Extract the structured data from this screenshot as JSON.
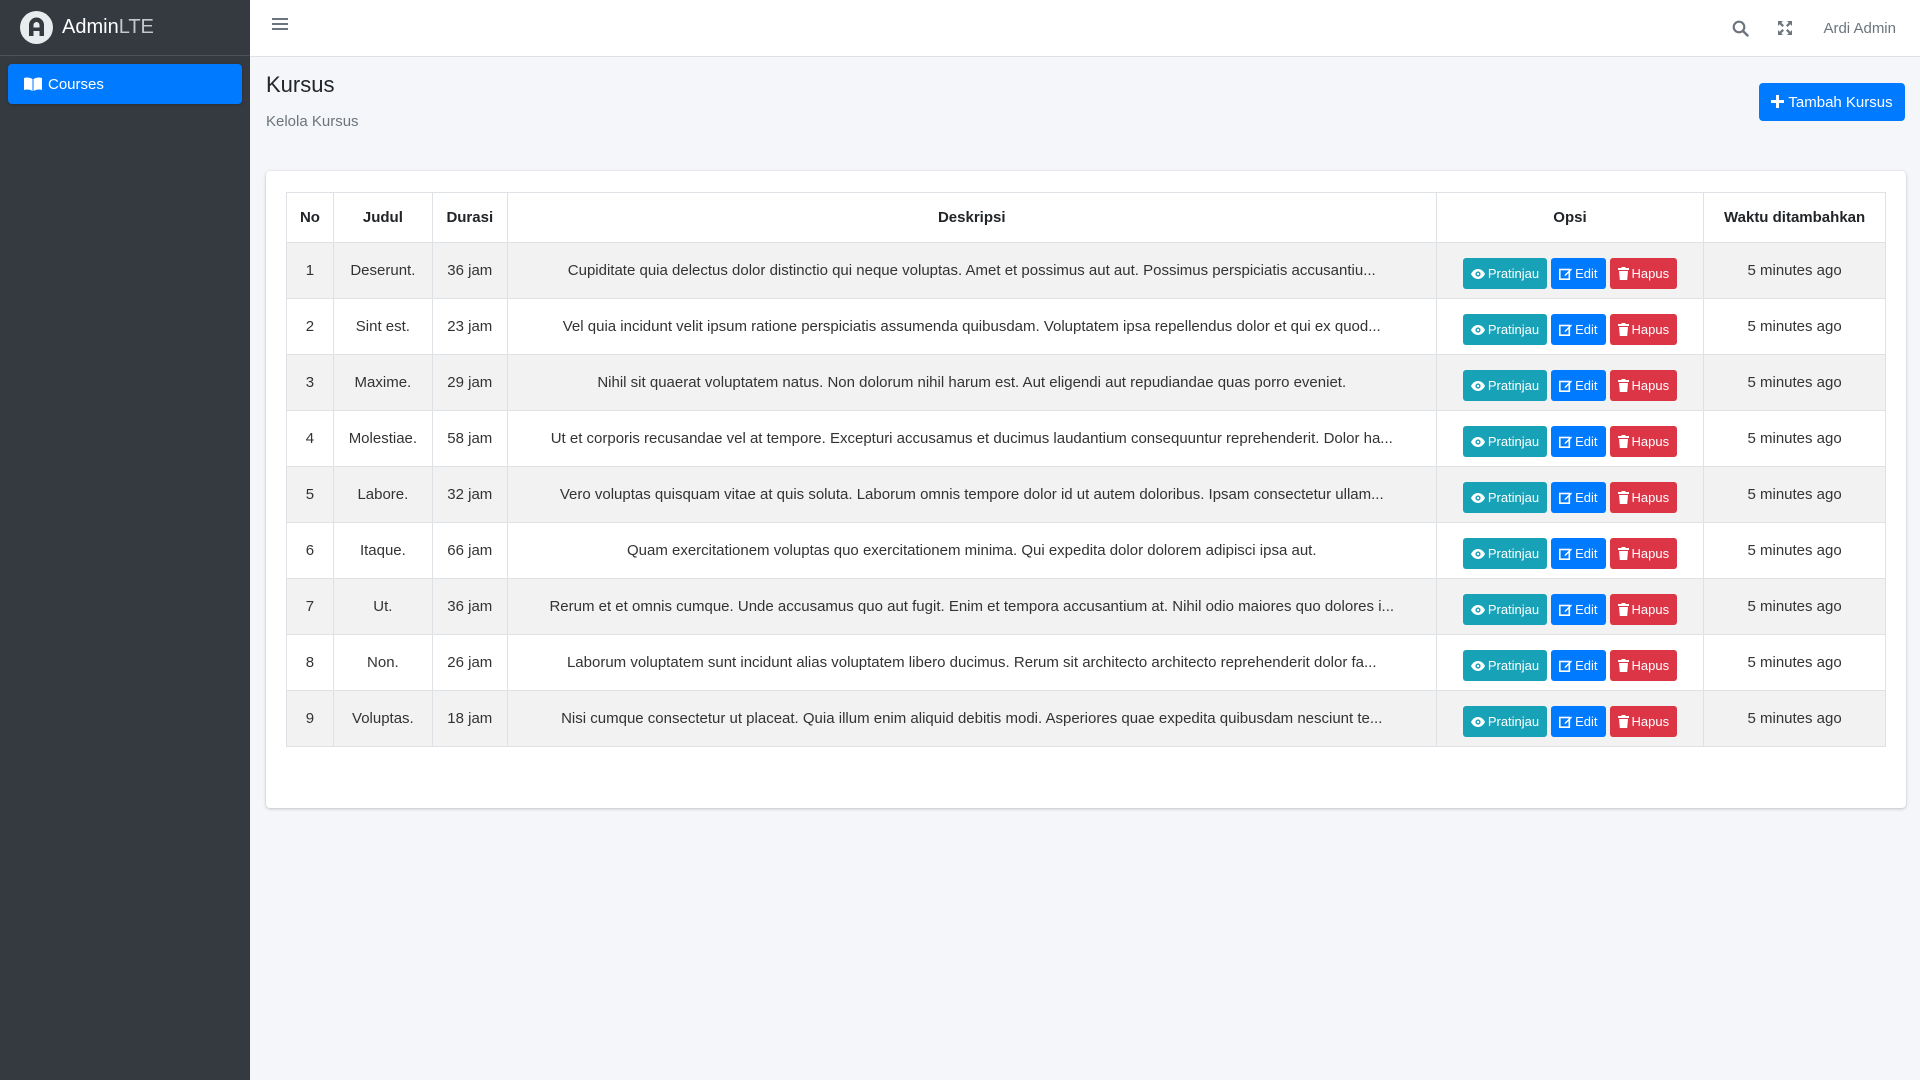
{
  "brand": {
    "name_bold": "Admin",
    "name_light": "LTE",
    "logo_icon": "adminlte-logo-icon"
  },
  "sidebar": {
    "items": [
      {
        "label": "Courses",
        "icon": "book-icon",
        "active": true
      }
    ]
  },
  "topbar": {
    "user": "Ardi Admin"
  },
  "page": {
    "title": "Kursus",
    "subtitle": "Kelola Kursus",
    "add_button": "Tambah Kursus"
  },
  "table": {
    "headers": [
      "No",
      "Judul",
      "Durasi",
      "Deskripsi",
      "Opsi",
      "Waktu ditambahkan"
    ],
    "actions": {
      "view": "Pratinjau",
      "edit": "Edit",
      "delete": "Hapus"
    },
    "rows": [
      {
        "no": "1",
        "judul": "Deserunt.",
        "durasi": "36 jam",
        "deskripsi": "Cupiditate quia delectus dolor distinctio qui neque voluptas. Amet et possimus aut aut. Possimus perspiciatis accusantiu...",
        "waktu": "5 minutes ago"
      },
      {
        "no": "2",
        "judul": "Sint est.",
        "durasi": "23 jam",
        "deskripsi": "Vel quia incidunt velit ipsum ratione perspiciatis assumenda quibusdam. Voluptatem ipsa repellendus dolor et qui ex quod...",
        "waktu": "5 minutes ago"
      },
      {
        "no": "3",
        "judul": "Maxime.",
        "durasi": "29 jam",
        "deskripsi": "Nihil sit quaerat voluptatem natus. Non dolorum nihil harum est. Aut eligendi aut repudiandae quas porro eveniet.",
        "waktu": "5 minutes ago"
      },
      {
        "no": "4",
        "judul": "Molestiae.",
        "durasi": "58 jam",
        "deskripsi": "Ut et corporis recusandae vel at tempore. Excepturi accusamus et ducimus laudantium consequuntur reprehenderit. Dolor ha...",
        "waktu": "5 minutes ago"
      },
      {
        "no": "5",
        "judul": "Labore.",
        "durasi": "32 jam",
        "deskripsi": "Vero voluptas quisquam vitae at quis soluta. Laborum omnis tempore dolor id ut autem doloribus. Ipsam consectetur ullam...",
        "waktu": "5 minutes ago"
      },
      {
        "no": "6",
        "judul": "Itaque.",
        "durasi": "66 jam",
        "deskripsi": "Quam exercitationem voluptas quo exercitationem minima. Qui expedita dolor dolorem adipisci ipsa aut.",
        "waktu": "5 minutes ago"
      },
      {
        "no": "7",
        "judul": "Ut.",
        "durasi": "36 jam",
        "deskripsi": "Rerum et et omnis cumque. Unde accusamus quo aut fugit. Enim et tempora accusantium at. Nihil odio maiores quo dolores i...",
        "waktu": "5 minutes ago"
      },
      {
        "no": "8",
        "judul": "Non.",
        "durasi": "26 jam",
        "deskripsi": "Laborum voluptatem sunt incidunt alias voluptatem libero ducimus. Rerum sit architecto architecto reprehenderit dolor fa...",
        "waktu": "5 minutes ago"
      },
      {
        "no": "9",
        "judul": "Voluptas.",
        "durasi": "18 jam",
        "deskripsi": "Nisi cumque consectetur ut placeat. Quia illum enim aliquid debitis modi. Asperiores quae expedita quibusdam nesciunt te...",
        "waktu": "5 minutes ago"
      }
    ]
  },
  "colors": {
    "primary": "#007bff",
    "info": "#17a2b8",
    "danger": "#dc3545",
    "sidebar": "#343a40"
  }
}
